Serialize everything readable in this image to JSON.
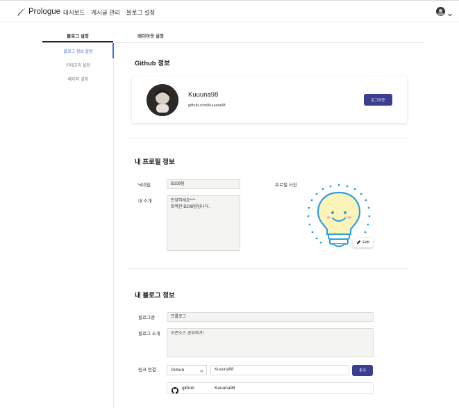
{
  "header": {
    "logo_text": "Prologue",
    "nav": [
      "대시보드",
      "게시글 관리",
      "블로그 설정"
    ]
  },
  "tabs": [
    "블로그 설정",
    "레이아웃 설정"
  ],
  "sidebar": {
    "items": [
      "블로그 정보 설정",
      "카테고리 설정",
      "페이지 설정"
    ],
    "active_index": 0
  },
  "github": {
    "title": "Github 정보",
    "username": "Kuuuna98",
    "url": "github.com/Kuuuna98",
    "logout_label": "로그아웃"
  },
  "profile": {
    "title": "내 프로필 정보",
    "nickname_label": "닉네임",
    "nickname_value": "B208팀",
    "intro_label": "내 소개",
    "intro_value": "안녕하세요^^*\n화목한 B208팀입니다.",
    "photo_label": "프로필 사진",
    "edit_label": "Edit"
  },
  "blog": {
    "title": "내 블로그 정보",
    "name_label": "블로그명",
    "name_value": "프롤로그",
    "intro_label": "블로그 소개",
    "intro_value": "오픈소스 공부하기!",
    "link_label": "링크 연결",
    "link_type": "Github",
    "link_value": "Kuuuna98",
    "add_label": "추가",
    "links": [
      {
        "name": "github",
        "user": "Kuuuna98"
      }
    ]
  },
  "colors": {
    "accent_button": "#3c3f91",
    "active_link": "#3a6fd8",
    "bulb_line": "#2a9ee0",
    "bulb_fill": "#fcf4b8"
  }
}
